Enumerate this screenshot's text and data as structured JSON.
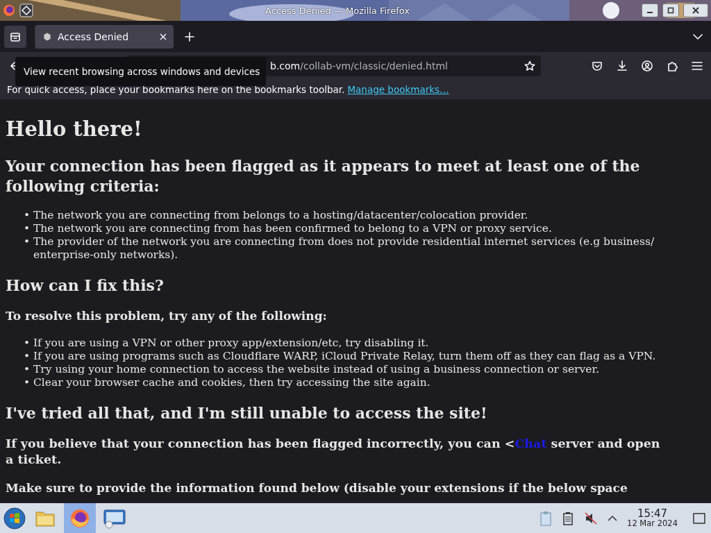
{
  "window": {
    "title": "Access Denied — Mozilla Firefox"
  },
  "tabs": [
    {
      "label": "Access Denied",
      "selected": true
    }
  ],
  "tooltip": "View recent browsing across windows and devices",
  "address_bar": {
    "url_host_part": "b.com",
    "url_path": "/collab-vm/classic/denied.html"
  },
  "bookmarks_bar": {
    "text": "For quick access, place your bookmarks here on the bookmarks toolbar.",
    "link": "Manage bookmarks…"
  },
  "page": {
    "blocks": [
      {
        "kind": "h1",
        "text": "Hello there!"
      },
      {
        "kind": "h2",
        "text": "Your connection has been flagged as it appears to meet at least one of the following criteria:"
      },
      {
        "kind": "list",
        "items": [
          {
            "bullet": "•",
            "text": "The network you are connecting from belongs to a hosting/datacenter/colocation provider."
          },
          {
            "bullet": "•",
            "text": "The network you are connecting from has been confirmed to belong to a VPN or proxy service."
          },
          {
            "bullet": "•",
            "text": "The provider of the network you are connecting from does not provide residential internet services (e.g business/ enterprise-only networks)."
          }
        ]
      },
      {
        "kind": "h2",
        "text": "How can I fix this?"
      },
      {
        "kind": "h3",
        "text": "To resolve this problem, try any of the following:"
      },
      {
        "kind": "list",
        "items": [
          {
            "bullet": "•",
            "text": "If you are using a VPN or other proxy app/extension/etc, try disabling it."
          },
          {
            "bullet": "•",
            "text": "If you are using programs such as Cloudflare WARP, iCloud Private Relay, turn them off as they can flag as a VPN."
          },
          {
            "bullet": "•",
            "text": "Try using your home connection to access the website instead of using a business connection or server."
          },
          {
            "bullet": "•",
            "text": "Clear your browser cache and cookies, then try accessing the site again."
          }
        ]
      },
      {
        "kind": "h2",
        "text": "I've tried all that, and I'm still unable to access the site!"
      },
      {
        "kind": "h3link",
        "before": "If you believe that your connection has been flagged incorrectly, you can <",
        "link": "Chat",
        "after": " server and open a ticket."
      },
      {
        "kind": "h3",
        "text": "Make sure to provide the information found below (disable your extensions if the below space"
      }
    ]
  },
  "taskbar": {
    "apps": [
      {
        "kind": "files",
        "selected": false
      },
      {
        "kind": "browser",
        "selected": true
      },
      {
        "kind": "vm",
        "selected": false
      }
    ],
    "time": "15:47",
    "date": "12 Mar 2024"
  }
}
